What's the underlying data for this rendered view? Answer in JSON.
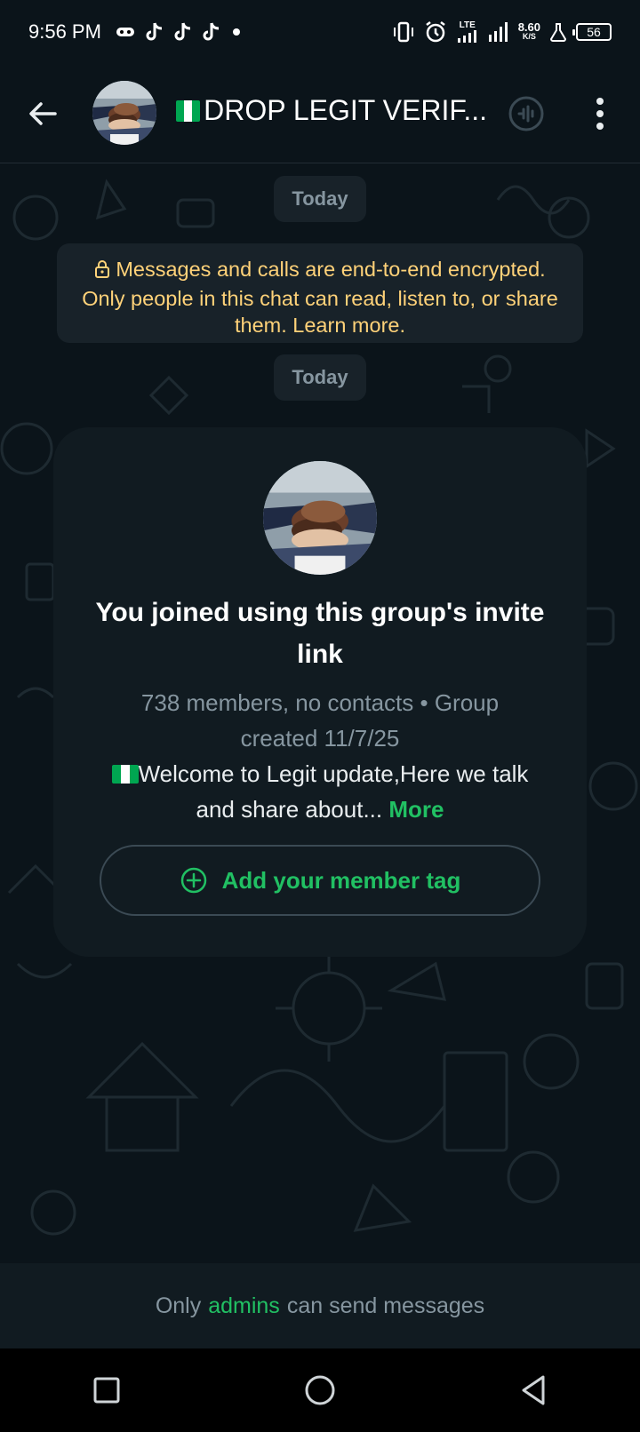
{
  "status_bar": {
    "time": "9:56 PM",
    "net_speed": "8.60",
    "net_unit": "K/S",
    "lte_label": "LTE",
    "battery": "56"
  },
  "header": {
    "group_name": "DROP LEGIT VERIF...",
    "icons": [
      "back-arrow-icon",
      "group-avatar",
      "nigeria-flag",
      "call-icon",
      "more-vert-icon"
    ]
  },
  "chat": {
    "date_chip_1": "Today",
    "encryption_notice": "Messages and calls are end-to-end encrypted. Only people in this chat can read, listen to, or share them. Learn more.",
    "date_chip_2": "Today"
  },
  "invite_card": {
    "title": "You joined using this group's invite link",
    "members_info": "738 members, no contacts • Group created 11/7/25",
    "description": "Welcome to Legit update,Here we talk and share about...",
    "more_label": "More",
    "member_tag_label": "Add your member tag"
  },
  "footer": {
    "prefix": "Only",
    "admins": "admins",
    "suffix": "can send messages"
  },
  "colors": {
    "background": "#0b141a",
    "accent_green": "#21c063",
    "encryption_text": "#ffd279",
    "bubble": "#182229"
  }
}
